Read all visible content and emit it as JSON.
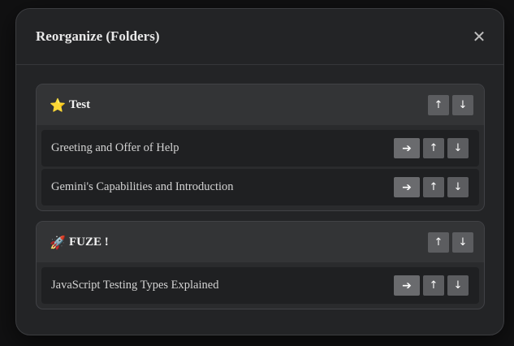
{
  "modal": {
    "title": "Reorganize (Folders)",
    "close_glyph": "✕"
  },
  "icons": {
    "up": "↑",
    "down": "↓",
    "move": "➔"
  },
  "folders": [
    {
      "emoji": "⭐",
      "emoji_icon": "star-icon",
      "name": "Test",
      "chats": [
        {
          "title": "Greeting and Offer of Help"
        },
        {
          "title": "Gemini's Capabilities and Introduction"
        }
      ]
    },
    {
      "emoji": "🚀",
      "emoji_icon": "rocket-icon",
      "name": "FUZE !",
      "chats": [
        {
          "title": "JavaScript Testing Types Explained"
        }
      ]
    }
  ],
  "colors": {
    "modal_bg": "#232426",
    "folder_head_bg": "#333436",
    "row_bg": "#1f2022",
    "button_bg": "#5c5d60"
  }
}
